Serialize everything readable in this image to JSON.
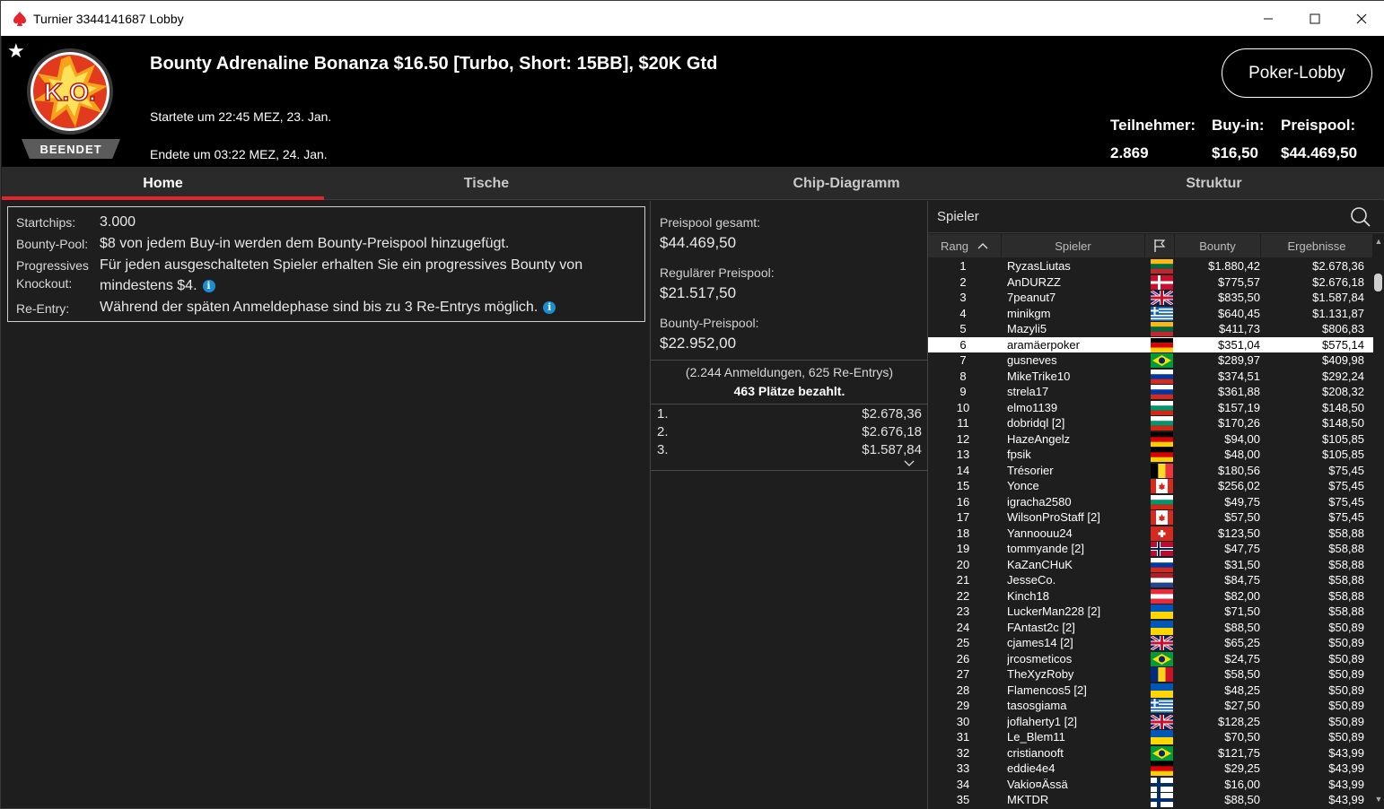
{
  "window": {
    "title": "Turnier 3344141687 Lobby"
  },
  "header": {
    "tournament_name": "Bounty Adrenaline Bonanza $16.50 [Turbo, Short: 15BB], $20K Gtd",
    "started": "Startete um 22:45 MEZ, 23. Jan.",
    "ended": "Endete um 03:22 MEZ, 24. Jan.",
    "status": "BEENDET",
    "ko_label": "K.O.",
    "lobby_button": "Poker-Lobby",
    "players_label": "Teilnehmer:",
    "players_value": "2.869",
    "buyin_label": "Buy-in:",
    "buyin_value": "$16,50",
    "prizepool_label": "Preispool:",
    "prizepool_value": "$44.469,50"
  },
  "tabs": [
    "Home",
    "Tische",
    "Chip-Diagramm",
    "Struktur"
  ],
  "info": {
    "startchips_label": "Startchips:",
    "startchips_value": "3.000",
    "bountypool_label": "Bounty-Pool:",
    "bountypool_value": "$8 von jedem Buy-in werden dem Bounty-Preispool hinzugefügt.",
    "pko_label_1": "Progressives",
    "pko_label_2": "Knockout:",
    "pko_value_1": "Für jeden ausgeschalteten Spieler erhalten Sie ein progressives Bounty von",
    "pko_value_2": "mindestens $4.",
    "reentry_label": "Re-Entry:",
    "reentry_value": "Während der späten Anmeldephase sind bis zu 3 Re-Entrys möglich."
  },
  "prizes": {
    "total_label": "Preispool gesamt:",
    "total_value": "$44.469,50",
    "regular_label": "Regulärer Preispool:",
    "regular_value": "$21.517,50",
    "bounty_label": "Bounty-Preispool:",
    "bounty_value": "$22.952,00",
    "registrations": "(2.244 Anmeldungen, 625 Re-Entrys)",
    "paid_places": "463 Plätze bezahlt.",
    "payouts": [
      {
        "rank": "1.",
        "amount": "$2.678,36"
      },
      {
        "rank": "2.",
        "amount": "$2.676,18"
      },
      {
        "rank": "3.",
        "amount": "$1.587,84"
      }
    ]
  },
  "players": {
    "search_label": "Spieler",
    "columns": {
      "rank": "Rang",
      "player": "Spieler",
      "bounty": "Bounty",
      "result": "Ergebnisse"
    },
    "rows": [
      {
        "rank": "1",
        "name": "RyzasLiutas",
        "flag": "lt",
        "bounty": "$1.880,42",
        "result": "$2.678,36"
      },
      {
        "rank": "2",
        "name": "AnDURZZ",
        "flag": "dk",
        "bounty": "$775,57",
        "result": "$2.676,18"
      },
      {
        "rank": "3",
        "name": "7peanut7",
        "flag": "gb",
        "bounty": "$835,50",
        "result": "$1.587,84"
      },
      {
        "rank": "4",
        "name": "minikgm",
        "flag": "gr",
        "bounty": "$640,45",
        "result": "$1.131,87"
      },
      {
        "rank": "5",
        "name": "Mazyli5",
        "flag": "lt",
        "bounty": "$411,73",
        "result": "$806,83"
      },
      {
        "rank": "6",
        "name": "aramäerpoker",
        "flag": "de",
        "bounty": "$351,04",
        "result": "$575,14"
      },
      {
        "rank": "7",
        "name": "gusneves",
        "flag": "br",
        "bounty": "$289,97",
        "result": "$409,98"
      },
      {
        "rank": "8",
        "name": "MikeTrike10",
        "flag": "ru",
        "bounty": "$374,51",
        "result": "$292,24"
      },
      {
        "rank": "9",
        "name": "strela17",
        "flag": "ru",
        "bounty": "$361,88",
        "result": "$208,32"
      },
      {
        "rank": "10",
        "name": "elmo1139",
        "flag": "bg",
        "bounty": "$157,19",
        "result": "$148,50"
      },
      {
        "rank": "11",
        "name": "dobridql [2]",
        "flag": "bg",
        "bounty": "$170,26",
        "result": "$148,50"
      },
      {
        "rank": "12",
        "name": "HazeAngelz",
        "flag": "de",
        "bounty": "$94,00",
        "result": "$105,85"
      },
      {
        "rank": "13",
        "name": "fpsik",
        "flag": "de",
        "bounty": "$48,00",
        "result": "$105,85"
      },
      {
        "rank": "14",
        "name": "Trésorier",
        "flag": "be",
        "bounty": "$180,56",
        "result": "$75,45"
      },
      {
        "rank": "15",
        "name": "Yonce",
        "flag": "ca",
        "bounty": "$256,02",
        "result": "$75,45"
      },
      {
        "rank": "16",
        "name": "igracha2580",
        "flag": "bg",
        "bounty": "$49,75",
        "result": "$75,45"
      },
      {
        "rank": "17",
        "name": "WilsonProStaff [2]",
        "flag": "ca",
        "bounty": "$57,50",
        "result": "$75,45"
      },
      {
        "rank": "18",
        "name": "Yannoouu24",
        "flag": "ch",
        "bounty": "$123,50",
        "result": "$58,88"
      },
      {
        "rank": "19",
        "name": "tommyande [2]",
        "flag": "no",
        "bounty": "$47,75",
        "result": "$58,88"
      },
      {
        "rank": "20",
        "name": "KaZanCHuK",
        "flag": "ru",
        "bounty": "$31,50",
        "result": "$58,88"
      },
      {
        "rank": "21",
        "name": "JesseCo.",
        "flag": "nl",
        "bounty": "$84,75",
        "result": "$58,88"
      },
      {
        "rank": "22",
        "name": "Kinch18",
        "flag": "at",
        "bounty": "$82,00",
        "result": "$58,88"
      },
      {
        "rank": "23",
        "name": "LuckerMan228 [2]",
        "flag": "ua",
        "bounty": "$71,50",
        "result": "$58,88"
      },
      {
        "rank": "24",
        "name": "FAntast2c [2]",
        "flag": "ua",
        "bounty": "$88,50",
        "result": "$50,89"
      },
      {
        "rank": "25",
        "name": "cjames14 [2]",
        "flag": "gb",
        "bounty": "$65,25",
        "result": "$50,89"
      },
      {
        "rank": "26",
        "name": "jrcosmeticos",
        "flag": "br",
        "bounty": "$24,75",
        "result": "$50,89"
      },
      {
        "rank": "27",
        "name": "TheXyzRoby",
        "flag": "ro",
        "bounty": "$58,50",
        "result": "$50,89"
      },
      {
        "rank": "28",
        "name": "Flamencos5 [2]",
        "flag": "ua",
        "bounty": "$48,25",
        "result": "$50,89"
      },
      {
        "rank": "29",
        "name": "tasosgiama",
        "flag": "gr",
        "bounty": "$27,50",
        "result": "$50,89"
      },
      {
        "rank": "30",
        "name": "joflaherty1 [2]",
        "flag": "gb",
        "bounty": "$128,25",
        "result": "$50,89"
      },
      {
        "rank": "31",
        "name": "Le_Blem11",
        "flag": "ua",
        "bounty": "$70,50",
        "result": "$50,89"
      },
      {
        "rank": "32",
        "name": "cristianooft",
        "flag": "br",
        "bounty": "$121,75",
        "result": "$43,99"
      },
      {
        "rank": "33",
        "name": "eddie4e4",
        "flag": "de",
        "bounty": "$29,25",
        "result": "$43,99"
      },
      {
        "rank": "34",
        "name": "Vakio¤Ässä",
        "flag": "fi",
        "bounty": "$16,00",
        "result": "$43,99"
      },
      {
        "rank": "35",
        "name": "MKTDR",
        "flag": "fi",
        "bounty": "$88,50",
        "result": "$43,99"
      }
    ],
    "highlight_rank": "6"
  }
}
